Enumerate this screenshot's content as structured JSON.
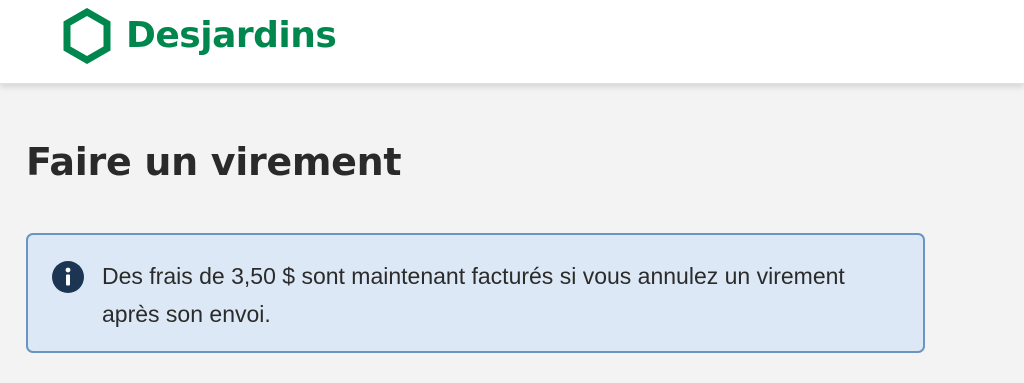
{
  "header": {
    "brand_name": "Desjardins",
    "brand_color": "#00874e",
    "logo_icon": "desjardins-hexagon-icon"
  },
  "page": {
    "title": "Faire un virement"
  },
  "info_banner": {
    "icon": "info-icon",
    "message": "Des frais de 3,50 $ sont maintenant facturés si vous annulez un virement après son envoi.",
    "background_color": "#dce8f5",
    "border_color": "#6a95c2"
  }
}
